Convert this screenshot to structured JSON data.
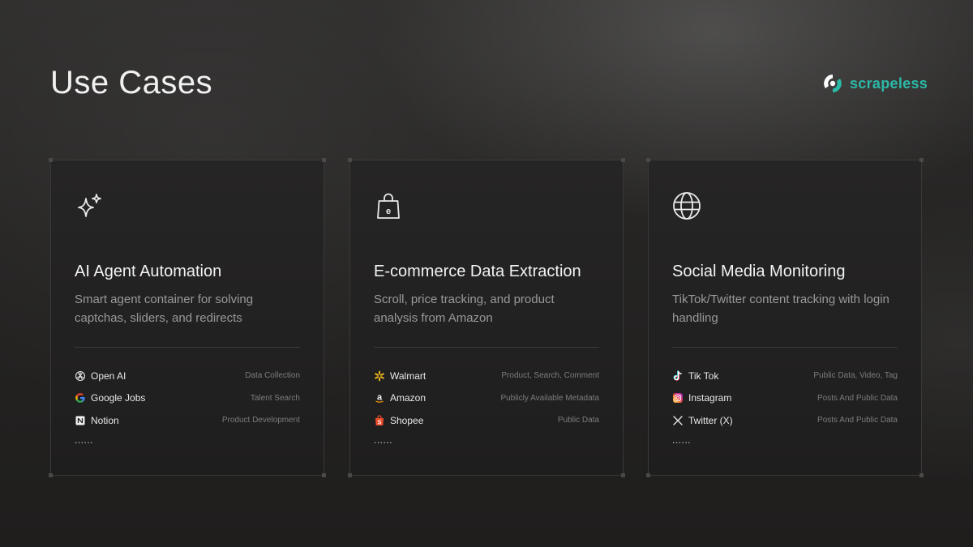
{
  "page": {
    "title": "Use Cases"
  },
  "brand": {
    "name": "scrapeless",
    "color": "#2bb9a8"
  },
  "cards": [
    {
      "icon": "sparkle-icon",
      "title": "AI Agent Automation",
      "description": "Smart agent container for solving captchas, sliders, and redirects",
      "items": [
        {
          "icon": "openai-icon",
          "name": "Open AI",
          "tag": "Data Collection"
        },
        {
          "icon": "google-icon",
          "name": "Google Jobs",
          "tag": "Talent Search"
        },
        {
          "icon": "notion-icon",
          "name": "Notion",
          "tag": "Product Development"
        }
      ],
      "more": "......"
    },
    {
      "icon": "shopping-bag-icon",
      "title": "E-commerce Data Extraction",
      "description": "Scroll, price tracking, and product analysis from Amazon",
      "items": [
        {
          "icon": "walmart-icon",
          "name": "Walmart",
          "tag": "Product, Search, Comment"
        },
        {
          "icon": "amazon-icon",
          "name": "Amazon",
          "tag": "Publicly Available Metadata"
        },
        {
          "icon": "shopee-icon",
          "name": "Shopee",
          "tag": "Public Data"
        }
      ],
      "more": "......"
    },
    {
      "icon": "globe-icon",
      "title": "Social Media Monitoring",
      "description": "TikTok/Twitter content tracking with login handling",
      "items": [
        {
          "icon": "tiktok-icon",
          "name": "Tik Tok",
          "tag": "Public Data, Video, Tag"
        },
        {
          "icon": "instagram-icon",
          "name": "Instagram",
          "tag": "Posts And Public Data"
        },
        {
          "icon": "x-icon",
          "name": "Twitter (X)",
          "tag": "Posts And Public Data"
        }
      ],
      "more": "......"
    }
  ]
}
